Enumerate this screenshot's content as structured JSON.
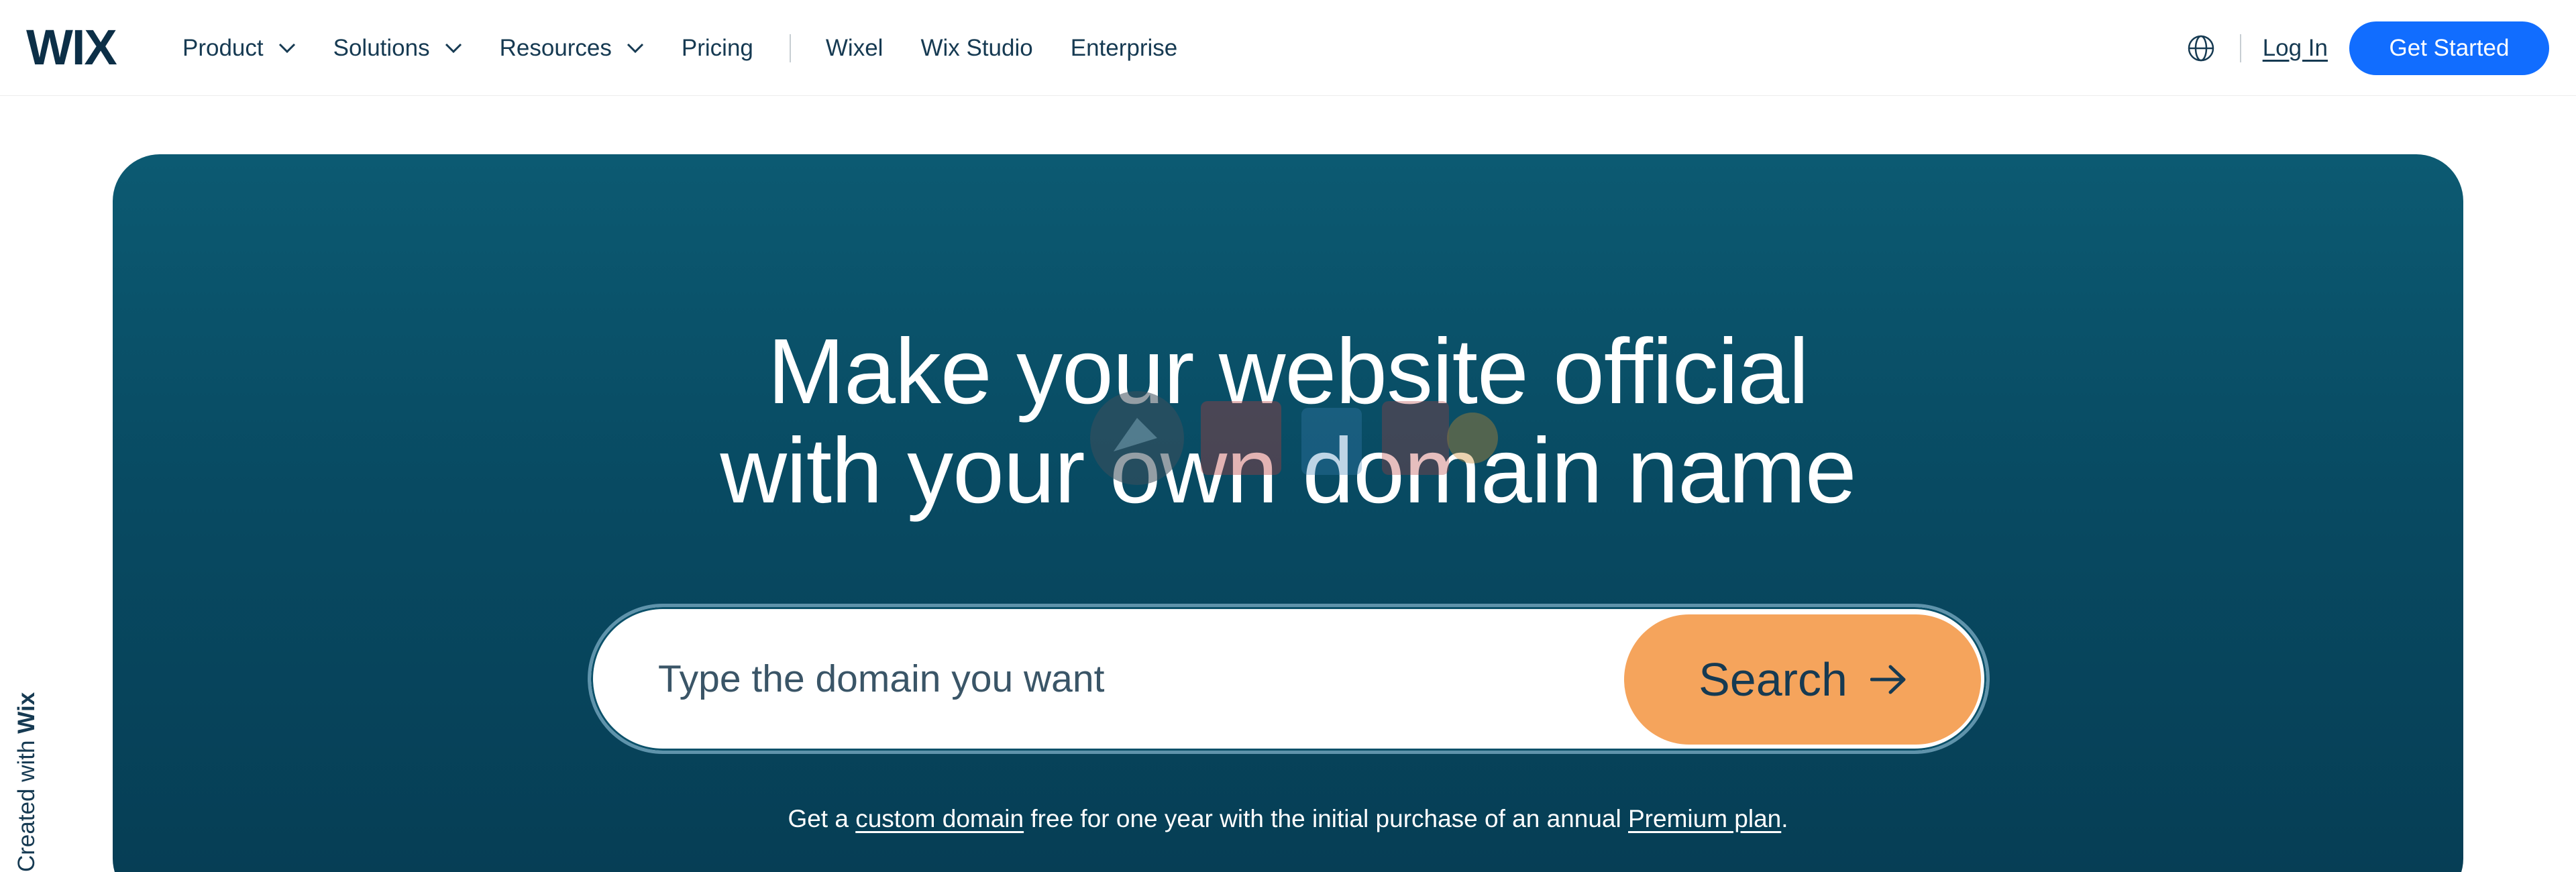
{
  "brand": {
    "logo_text": "WIX",
    "accent_color": "#116dff",
    "primary_dark": "#0c2f47"
  },
  "header": {
    "nav_items": [
      {
        "label": "Product",
        "has_dropdown": true
      },
      {
        "label": "Solutions",
        "has_dropdown": true
      },
      {
        "label": "Resources",
        "has_dropdown": true
      },
      {
        "label": "Pricing",
        "has_dropdown": false
      }
    ],
    "secondary_nav": [
      {
        "label": "Wixel"
      },
      {
        "label": "Wix Studio"
      },
      {
        "label": "Enterprise"
      }
    ],
    "language_icon": "globe-icon",
    "login_label": "Log In",
    "cta_label": "Get Started"
  },
  "hero": {
    "title_line1": "Make your website official",
    "title_line2": "with your own domain name",
    "background_color": "#084a62",
    "search": {
      "placeholder": "Type the domain you want",
      "value": "",
      "button_label": "Search",
      "button_icon": "arrow-right-icon",
      "button_color": "#f5a45c"
    },
    "promo": {
      "prefix": "Get a",
      "link1": "custom domain",
      "middle": "free for one year with the initial purchase of an annual",
      "link2": "Premium plan",
      "suffix": "."
    }
  },
  "side_badge": {
    "prefix": "Created with",
    "brand": "Wix"
  }
}
